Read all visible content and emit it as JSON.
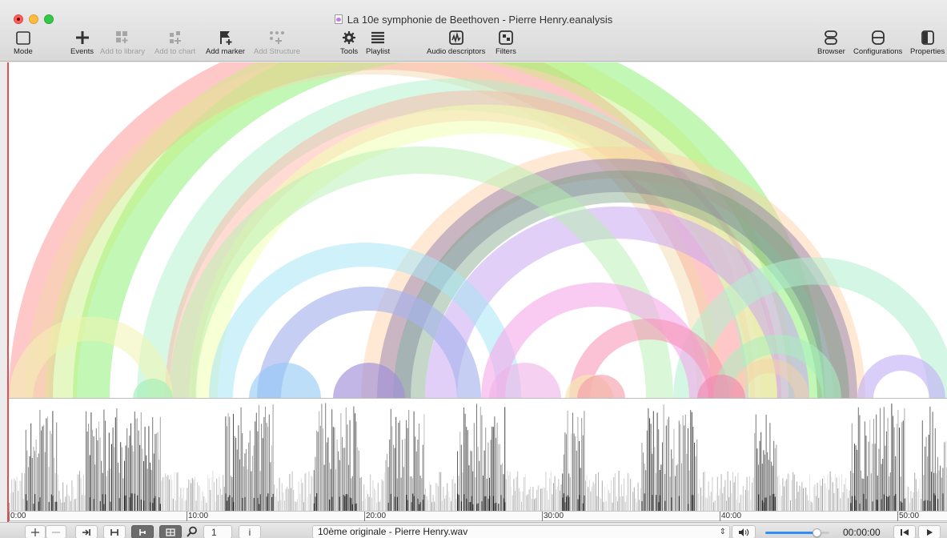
{
  "window": {
    "title": "La 10e symphonie de Beethoven - Pierre Henry.eanalysis"
  },
  "toolbar": {
    "mode": "Mode",
    "events": "Events",
    "add_to_library": "Add to library",
    "add_to_chart": "Add to chart",
    "add_marker": "Add marker",
    "add_structure": "Add Structure",
    "tools": "Tools",
    "playlist": "Playlist",
    "audio_descriptors": "Audio descriptors",
    "filters": "Filters",
    "browser": "Browser",
    "configurations": "Configurations",
    "properties": "Properties"
  },
  "timeline": {
    "ticks": [
      "0:00",
      "10:00",
      "20:00",
      "30:00",
      "40:00",
      "50:00"
    ]
  },
  "arcs": [
    {
      "a": 0,
      "b": 932,
      "w": 55,
      "color": "#ff9a9a",
      "op": 0.55
    },
    {
      "a": 80,
      "b": 1020,
      "w": 46,
      "color": "#8ff07a",
      "op": 0.55
    },
    {
      "a": 45,
      "b": 980,
      "w": 40,
      "color": "#c6f07a",
      "op": 0.45
    },
    {
      "a": 20,
      "b": 890,
      "w": 30,
      "color": "#f4d8a8",
      "op": 0.45
    },
    {
      "a": 160,
      "b": 960,
      "w": 40,
      "color": "#a8f0c8",
      "op": 0.45
    },
    {
      "a": 195,
      "b": 965,
      "w": 38,
      "color": "#ffb0a0",
      "op": 0.45
    },
    {
      "a": 225,
      "b": 960,
      "w": 36,
      "color": "#f0ffb0",
      "op": 0.55
    },
    {
      "a": 440,
      "b": 1070,
      "w": 40,
      "color": "#ffcfa0",
      "op": 0.45
    },
    {
      "a": 460,
      "b": 1060,
      "w": 42,
      "color": "#7a6aa8",
      "op": 0.4
    },
    {
      "a": 480,
      "b": 1050,
      "w": 40,
      "color": "#6f9a78",
      "op": 0.4
    },
    {
      "a": 520,
      "b": 1000,
      "w": 40,
      "color": "#c8a8f0",
      "op": 0.55
    },
    {
      "a": 830,
      "b": 1183,
      "w": 34,
      "color": "#b0f0d0",
      "op": 0.55
    },
    {
      "a": 200,
      "b": 830,
      "w": 34,
      "color": "#b5f0b0",
      "op": 0.5
    },
    {
      "a": 250,
      "b": 640,
      "w": 30,
      "color": "#a8e6f4",
      "op": 0.55
    },
    {
      "a": 310,
      "b": 590,
      "w": 30,
      "color": "#a8b4ee",
      "op": 0.65
    },
    {
      "a": 0,
      "b": 205,
      "w": 30,
      "color": "#f0f4b0",
      "op": 0.55
    },
    {
      "a": 590,
      "b": 880,
      "w": 30,
      "color": "#f5a8ea",
      "op": 0.6
    },
    {
      "a": 700,
      "b": 900,
      "w": 26,
      "color": "#f590b0",
      "op": 0.55
    },
    {
      "a": 880,
      "b": 1040,
      "w": 24,
      "color": "#a8f0c0",
      "op": 0.55
    },
    {
      "a": 1060,
      "b": 1170,
      "w": 20,
      "color": "#c0aef5",
      "op": 0.6
    },
    {
      "a": 900,
      "b": 1000,
      "w": 18,
      "color": "#f5d2a8",
      "op": 0.5
    },
    {
      "a": 155,
      "b": 205,
      "w": 25,
      "color": "#a8f0b8",
      "op": 0.7
    },
    {
      "a": 300,
      "b": 390,
      "w": 45,
      "color": "#8fc8f5",
      "op": 0.6
    },
    {
      "a": 405,
      "b": 495,
      "w": 45,
      "color": "#9f8fd8",
      "op": 0.65
    },
    {
      "a": 600,
      "b": 690,
      "w": 45,
      "color": "#f0b0e8",
      "op": 0.6
    },
    {
      "a": 695,
      "b": 755,
      "w": 30,
      "color": "#f5e6b0",
      "op": 0.7
    },
    {
      "a": 710,
      "b": 770,
      "w": 30,
      "color": "#f59aa8",
      "op": 0.6
    },
    {
      "a": 860,
      "b": 920,
      "w": 30,
      "color": "#f08ab0",
      "op": 0.65
    }
  ],
  "bottombar": {
    "zoom_value": "1",
    "info_button": "i",
    "file_name": "10ème originale - Pierre Henry.wav",
    "volume_percent": 80,
    "timecode": "00:00:00"
  }
}
